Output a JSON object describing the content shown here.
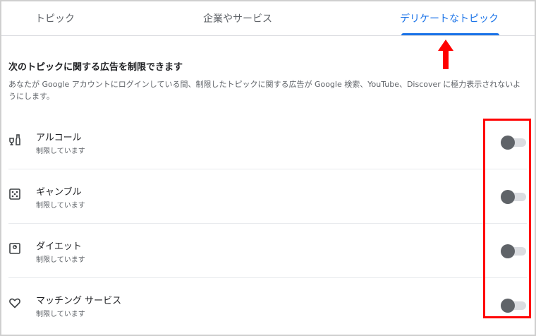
{
  "tabs": [
    {
      "label": "トピック",
      "selected": false
    },
    {
      "label": "企業やサービス",
      "selected": false
    },
    {
      "label": "デリケートなトピック",
      "selected": true
    }
  ],
  "section": {
    "heading": "次のトピックに関する広告を制限できます",
    "description": "あなたが Google アカウントにログインしている間、制限したトピックに関する広告が Google 検索、YouTube、Discover に極力表示されないようにします。"
  },
  "topics": [
    {
      "icon": "alcohol-icon",
      "title": "アルコール",
      "status": "制限しています",
      "toggle_on": false
    },
    {
      "icon": "dice-icon",
      "title": "ギャンブル",
      "status": "制限しています",
      "toggle_on": false
    },
    {
      "icon": "scale-icon",
      "title": "ダイエット",
      "status": "制限しています",
      "toggle_on": false
    },
    {
      "icon": "heart-icon",
      "title": "マッチング サービス",
      "status": "制限しています",
      "toggle_on": false
    }
  ],
  "colors": {
    "accent": "#1a73e8",
    "annotation": "#ff0000",
    "toggle_knob": "#5f6368",
    "toggle_track": "#dadce0"
  }
}
